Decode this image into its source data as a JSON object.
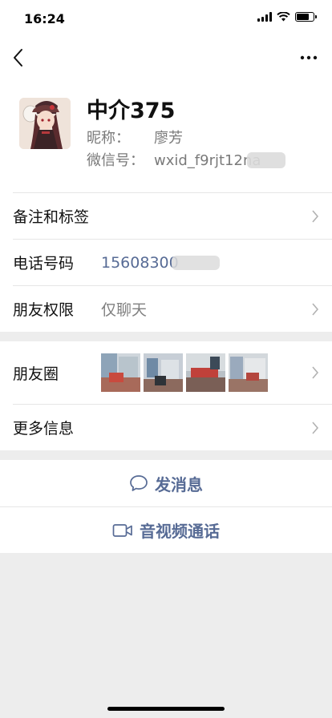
{
  "status_bar": {
    "time": "16:24"
  },
  "profile": {
    "name": "中介375",
    "nickname_label": "昵称：",
    "nickname": "廖芳",
    "wechat_id_label": "微信号：",
    "wechat_id": "wxid_f9rjt12na"
  },
  "cells": {
    "remark_label": "备注和标签",
    "phone_label": "电话号码",
    "phone_value": "15608300",
    "permission_label": "朋友权限",
    "permission_value": "仅聊天",
    "moments_label": "朋友圈",
    "more_info_label": "更多信息"
  },
  "actions": {
    "send_message": "发消息",
    "video_call": "音视频通话"
  },
  "colors": {
    "accent_link": "#576b95",
    "background": "#ededed"
  }
}
